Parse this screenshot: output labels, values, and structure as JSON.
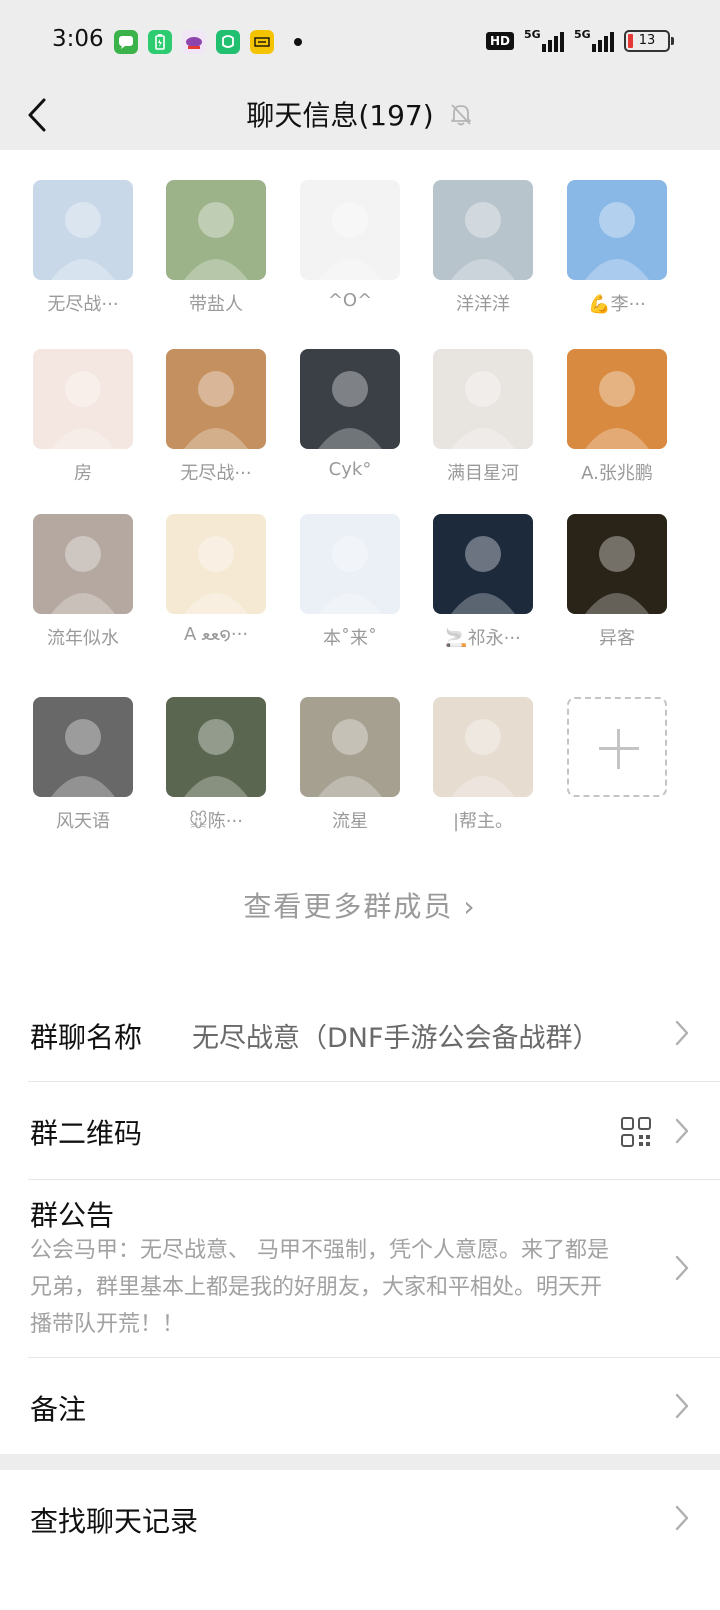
{
  "status_bar": {
    "time": "3:06",
    "apps": [
      {
        "icon": "wechat-icon",
        "color": "#3cb34a"
      },
      {
        "icon": "battery-app-icon",
        "color": "#2ecc71"
      },
      {
        "icon": "game-app-icon",
        "color": "#8e44ad"
      },
      {
        "icon": "mi-app-icon",
        "color": "#20c070"
      },
      {
        "icon": "yellow-app-icon",
        "color": "#f5c400"
      }
    ],
    "hd": "HD",
    "network1": "5G",
    "network2": "5G",
    "battery": "13"
  },
  "header": {
    "title": "聊天信息(197)"
  },
  "members": [
    {
      "name": "无尽战···",
      "color": "#c8d8e8"
    },
    {
      "name": "带盐人",
      "color": "#9cb38a"
    },
    {
      "name": "^O^",
      "color": "#f3f3f3"
    },
    {
      "name": "洋洋洋",
      "color": "#b8c4cc"
    },
    {
      "name": "💪李···",
      "color": "#8ab8e6"
    },
    {
      "name": "房",
      "color": "#f4e6e0"
    },
    {
      "name": "无尽战···",
      "color": "#c49060"
    },
    {
      "name": "Cyk°",
      "color": "#3a4046"
    },
    {
      "name": "满目星河",
      "color": "#e8e4e0"
    },
    {
      "name": "A.张兆鹏",
      "color": "#d88a40"
    },
    {
      "name": "流年似水",
      "color": "#b4a8a0"
    },
    {
      "name": "A  ﻌﻌ໑···",
      "color": "#f6e9d4"
    },
    {
      "name": "本˚来˚",
      "color": "#eaf0f6"
    },
    {
      "name": "🚬祁永···",
      "color": "#1c2a3c"
    },
    {
      "name": "异客",
      "color": "#2a2418"
    },
    {
      "name": "风天语",
      "color": "#686868"
    },
    {
      "name": "🐭陈···",
      "color": "#5a6650"
    },
    {
      "name": "流星",
      "color": "#a6a090"
    },
    {
      "name": "|帮主。",
      "color": "#e6dcd0"
    }
  ],
  "view_more": "查看更多群成员",
  "group_name": {
    "label": "群聊名称",
    "value": "无尽战意（DNF手游公会备战群）"
  },
  "qr_code": {
    "label": "群二维码"
  },
  "announcement": {
    "label": "群公告",
    "text": "公会马甲：无尽战意、   马甲不强制，凭个人意愿。来了都是兄弟，群里基本上都是我的好朋友，大家和平相处。明天开播带队开荒！！"
  },
  "remark": {
    "label": "备注"
  },
  "search_history": {
    "label": "查找聊天记录"
  }
}
